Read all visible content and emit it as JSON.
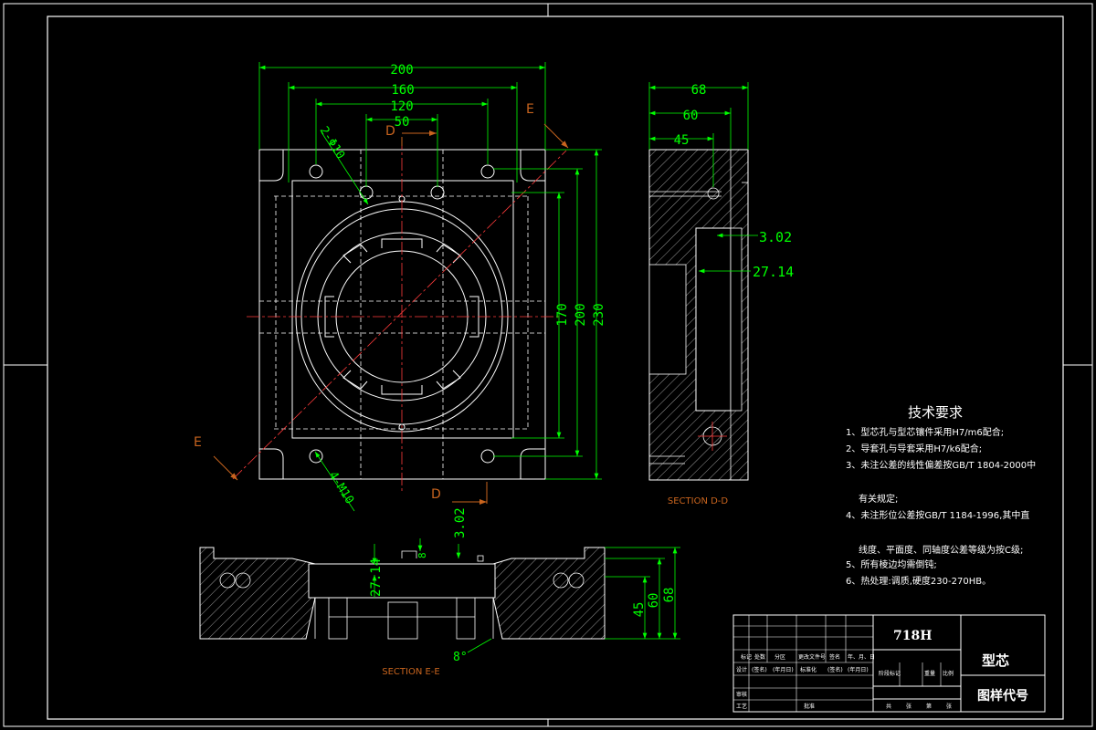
{
  "top_view": {
    "dims": {
      "w200": "200",
      "w160": "160",
      "w120": "120",
      "w50": "50",
      "hole_2": "2-Φ10",
      "tap_4": "4-M10",
      "h170": "170",
      "h200": "200",
      "h230": "230"
    },
    "markers": {
      "d_top": "D",
      "d_bottom": "D",
      "e_top": "E",
      "e_bottom": "E"
    }
  },
  "section_dd": {
    "title": "SECTION D-D",
    "dims": {
      "w68": "68",
      "w60": "60",
      "w45": "45",
      "d302": "3.02",
      "d2714": "27.14"
    }
  },
  "section_ee": {
    "title": "SECTION E-E",
    "dims": {
      "d302": "3.02",
      "d2714": "27.14",
      "h45": "45",
      "h60": "60",
      "h68": "68",
      "angle": "8°",
      "small": "8"
    }
  },
  "tech_req": {
    "title": "技术要求",
    "lines": [
      "1、型芯孔与型芯镶件采用H7/m6配合;",
      "2、导套孔与导套采用H7/k6配合;",
      "3、未注公差的线性偏差按GB/T 1804-2000中",
      "有关规定;",
      "4、未注形位公差按GB/T 1184-1996,其中直",
      "线度、平面度、同轴度公差等级为按C级;",
      "5、所有棱边均需倒钝;",
      "6、热处理:调质,硬度230-270HB。"
    ]
  },
  "title_block": {
    "material": "718H",
    "part_name": "型芯",
    "drawing_code": "图样代号",
    "row_labels": [
      "标记",
      "处数",
      "分区",
      "更改文件号",
      "签名",
      "年、月、日"
    ],
    "design_labels": [
      "设计",
      "(签名)",
      "(年月日)",
      "标准化",
      "(签名)",
      "(年月日)"
    ],
    "stage_labels": [
      "阶段标记",
      "重量",
      "比例"
    ],
    "check_label": "审核",
    "process_label": "工艺",
    "approve_label": "批准",
    "sheet_labels": [
      "共",
      "张",
      "第",
      "张"
    ]
  }
}
